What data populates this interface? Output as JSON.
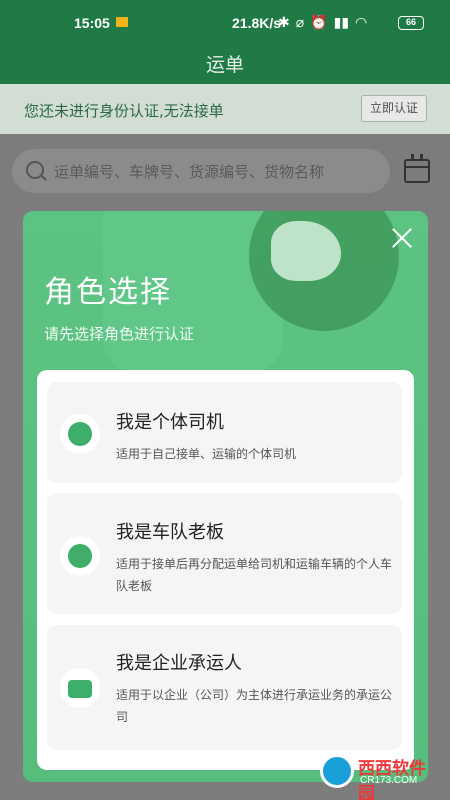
{
  "status_bar": {
    "time": "15:05",
    "network_speed": "21.8K/s",
    "icons": [
      "bluetooth-icon",
      "mute-icon",
      "alarm-icon",
      "signal-icon",
      "wifi-icon"
    ],
    "battery": "66"
  },
  "header": {
    "title": "运单"
  },
  "notice": {
    "text": "您还未进行身份认证,无法接单",
    "button_label": "立即认证"
  },
  "search": {
    "placeholder": "运单编号、车牌号、货源编号、货物名称"
  },
  "modal": {
    "title": "角色选择",
    "subtitle": "请先选择角色进行认证",
    "roles": [
      {
        "title": "我是个体司机",
        "desc": "适用于自己接单、运输的个体司机",
        "icon": "driver-icon"
      },
      {
        "title": "我是车队老板",
        "desc": "适用于接单后再分配运单给司机和运输车辆的个人车队老板",
        "icon": "fleet-owner-icon"
      },
      {
        "title": "我是企业承运人",
        "desc": "适用于以企业（公司）为主体进行承运业务的承运公司",
        "icon": "briefcase-icon"
      }
    ]
  },
  "watermark": {
    "brand": "西西软件园",
    "url": "CR173.COM"
  },
  "colors": {
    "primary": "#1f7a45",
    "modal_green": "#5cc383",
    "icon_green": "#3fae6a"
  }
}
